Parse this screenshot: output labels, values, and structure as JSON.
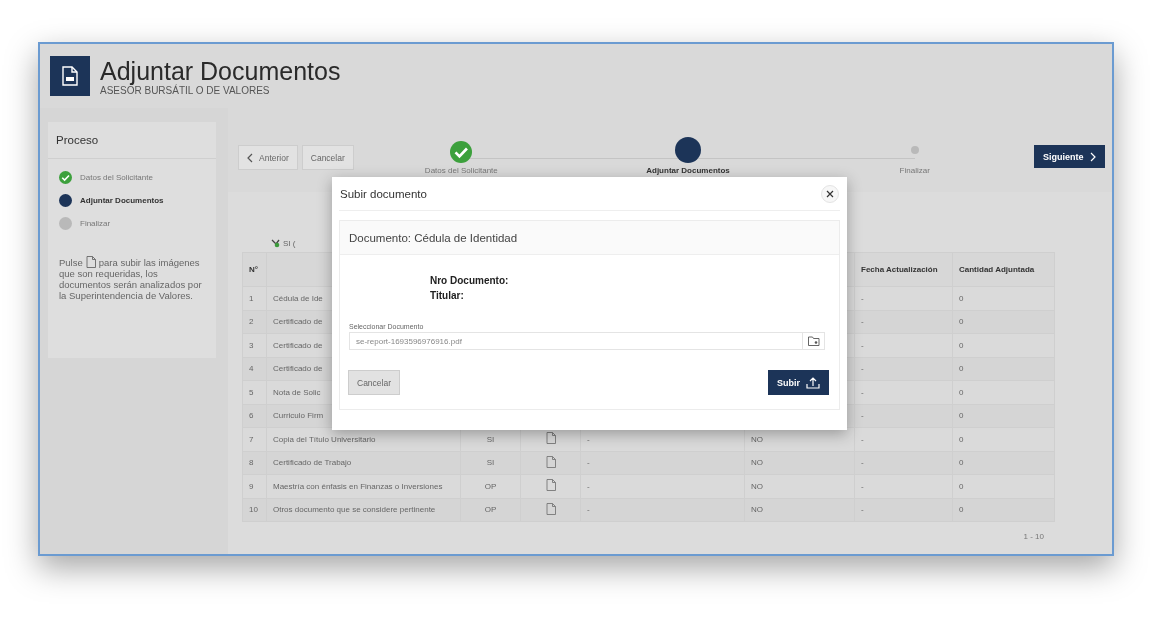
{
  "header": {
    "title": "Adjuntar Documentos",
    "subtitle": "ASESOR BURSÁTIL O DE VALORES"
  },
  "sidebar": {
    "title": "Proceso",
    "steps": [
      {
        "label": "Datos del Solicitante",
        "completed": true,
        "current": false
      },
      {
        "label": "Adjuntar Documentos",
        "completed": false,
        "current": true
      },
      {
        "label": "Finalizar",
        "completed": false,
        "current": false
      }
    ],
    "help_before": "Pulse",
    "help_after": "para subir las imágenes",
    "help_rest": "que son requeridas, los documentos serán analizados por la Superintendencia de Valores."
  },
  "toolbar": {
    "back": "Anterior",
    "cancel": "Cancelar",
    "next": "Siguiente"
  },
  "stepper": [
    {
      "label": "Datos del Solicitante",
      "completed": true,
      "current": false
    },
    {
      "label": "Adjuntar Documentos",
      "completed": false,
      "current": true
    },
    {
      "label": "Finalizar",
      "completed": false,
      "current": false
    }
  ],
  "legend": "SI (",
  "table": {
    "columns": [
      "N°",
      null,
      null,
      null,
      null,
      null,
      "Fecha Actualización",
      "Cantidad Adjuntada"
    ],
    "rows": [
      {
        "cells": [
          "1",
          "Cédula de Ide",
          null,
          null,
          null,
          null,
          "-",
          "0"
        ]
      },
      {
        "cells": [
          "2",
          "Certificado de",
          null,
          null,
          null,
          null,
          "-",
          "0"
        ]
      },
      {
        "cells": [
          "3",
          "Certificado de",
          null,
          null,
          null,
          null,
          "-",
          "0"
        ]
      },
      {
        "cells": [
          "4",
          "Certificado de",
          null,
          null,
          null,
          null,
          "-",
          "0"
        ]
      },
      {
        "cells": [
          "5",
          "Nota de Solic",
          null,
          null,
          null,
          null,
          "-",
          "0"
        ]
      },
      {
        "cells": [
          "6",
          "Curriculo Firm",
          null,
          null,
          null,
          null,
          "-",
          "0"
        ]
      },
      {
        "cells": [
          "7",
          "Copia del Título Universitario",
          "SI",
          null,
          "-",
          "NO",
          "-",
          "0"
        ],
        "upload_icon": true
      },
      {
        "cells": [
          "8",
          "Certificado de Trabajo",
          "SI",
          null,
          "-",
          "NO",
          "-",
          "0"
        ],
        "upload_icon": true
      },
      {
        "cells": [
          "9",
          "Maestría con énfasis en Finanzas o Inversiones",
          "OP",
          null,
          "-",
          "NO",
          "-",
          "0"
        ],
        "upload_icon": true
      },
      {
        "cells": [
          "10",
          "Otros documento que se considere pertinente",
          "OP",
          null,
          "-",
          "NO",
          "-",
          "0"
        ],
        "upload_icon": true
      }
    ],
    "pagination": "1 - 10"
  },
  "modal": {
    "title": "Subir documento",
    "card_title": "Documento: Cédula de Identidad",
    "fields": [
      "Nro Documento:",
      "Titular:"
    ],
    "file_label": "Seleccionar Documento",
    "file_value": "se-report-1693596976916.pdf",
    "cancel": "Cancelar",
    "submit": "Subir"
  }
}
